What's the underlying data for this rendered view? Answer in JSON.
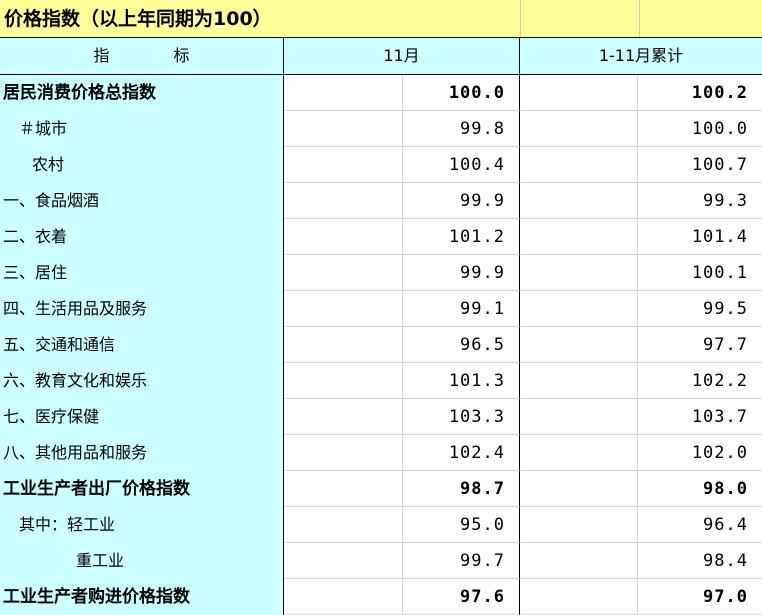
{
  "title": "价格指数（以上年同期为100）",
  "header": {
    "col_indicator_1": "指",
    "col_indicator_2": "标",
    "col_month": "11月",
    "col_cumulative": "1-11月累计"
  },
  "rows": [
    {
      "label": "居民消费价格总指数",
      "month": "100.0",
      "cumulative": "100.2",
      "bold": true,
      "indent": 0
    },
    {
      "label": "＃城市",
      "month": "99.8",
      "cumulative": "100.0",
      "bold": false,
      "indent": 1
    },
    {
      "label": "农村",
      "month": "100.4",
      "cumulative": "100.7",
      "bold": false,
      "indent": 2
    },
    {
      "label": "一、食品烟酒",
      "month": "99.9",
      "cumulative": "99.3",
      "bold": false,
      "indent": 0
    },
    {
      "label": "二、衣着",
      "month": "101.2",
      "cumulative": "101.4",
      "bold": false,
      "indent": 0
    },
    {
      "label": "三、居住",
      "month": "99.9",
      "cumulative": "100.1",
      "bold": false,
      "indent": 0
    },
    {
      "label": "四、生活用品及服务",
      "month": "99.1",
      "cumulative": "99.5",
      "bold": false,
      "indent": 0
    },
    {
      "label": "五、交通和通信",
      "month": "96.5",
      "cumulative": "97.7",
      "bold": false,
      "indent": 0
    },
    {
      "label": "六、教育文化和娱乐",
      "month": "101.3",
      "cumulative": "102.2",
      "bold": false,
      "indent": 0
    },
    {
      "label": "七、医疗保健",
      "month": "103.3",
      "cumulative": "103.7",
      "bold": false,
      "indent": 0
    },
    {
      "label": "八、其他用品和服务",
      "month": "102.4",
      "cumulative": "102.0",
      "bold": false,
      "indent": 0
    },
    {
      "label": "工业生产者出厂价格指数",
      "month": "98.7",
      "cumulative": "98.0",
      "bold": true,
      "indent": 0
    },
    {
      "label": "其中：轻工业",
      "month": "95.0",
      "cumulative": "96.4",
      "bold": false,
      "indent": 1
    },
    {
      "label": "重工业",
      "month": "99.7",
      "cumulative": "98.4",
      "bold": false,
      "indent": 3
    },
    {
      "label": "工业生产者购进价格指数",
      "month": "97.6",
      "cumulative": "97.0",
      "bold": true,
      "indent": 0
    }
  ]
}
